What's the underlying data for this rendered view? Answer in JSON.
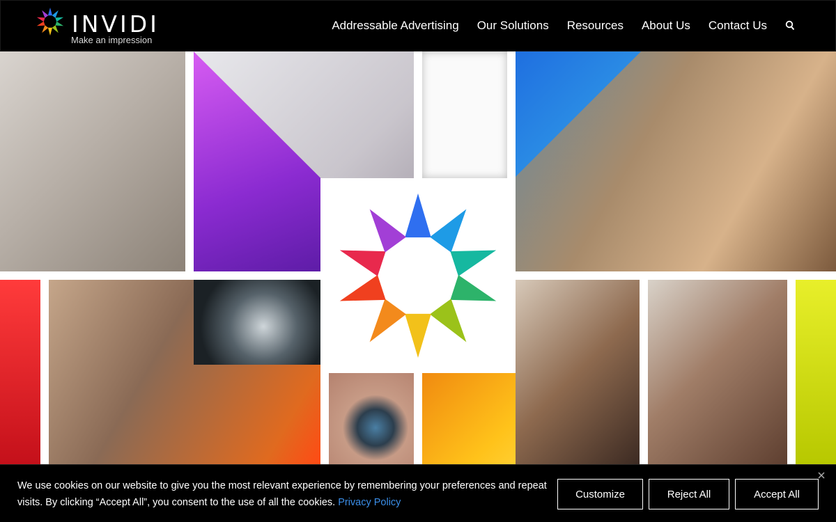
{
  "header": {
    "brand": "INVIDI",
    "tagline": "Make an impression",
    "nav": [
      {
        "label": "Addressable Advertising"
      },
      {
        "label": "Our Solutions"
      },
      {
        "label": "Resources"
      },
      {
        "label": "About Us"
      },
      {
        "label": "Contact Us"
      }
    ],
    "search_icon": "search-icon"
  },
  "hero": {
    "logo_mark_colors": [
      "#2f6ff0",
      "#1e9be6",
      "#16b8a0",
      "#2db36a",
      "#9bc21a",
      "#f2c11a",
      "#f38a1c",
      "#f0401f",
      "#e8294d",
      "#a23fd6"
    ]
  },
  "cookie": {
    "text": "We use cookies on our website to give you the most relevant experience by remembering your preferences and repeat visits. By clicking “Accept All”, you consent to the use of all the cookies.",
    "link": "Privacy Policy",
    "customize": "Customize",
    "reject": "Reject All",
    "accept": "Accept All",
    "close_icon": "close-icon"
  },
  "colors": {
    "background": "#000000",
    "link": "#3b8ee8"
  }
}
